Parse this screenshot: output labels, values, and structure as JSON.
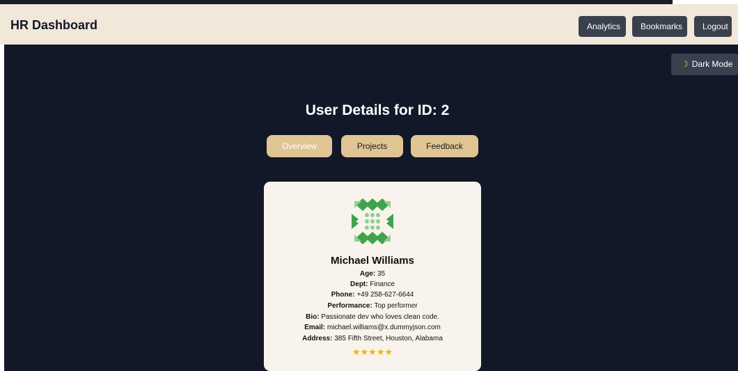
{
  "navbar": {
    "title": "HR Dashboard",
    "buttons": [
      "Analytics",
      "Bookmarks",
      "Logout"
    ]
  },
  "theme_toggle": {
    "icon": "moon-icon",
    "label": "Dark Mode"
  },
  "page": {
    "title": "User Details for ID: 2"
  },
  "tabs": {
    "items": [
      "Overview",
      "Projects",
      "Feedback"
    ],
    "active": "Overview"
  },
  "user": {
    "avatar_icon": "identicon-avatar",
    "name": "Michael Williams",
    "fields": {
      "age": {
        "label": "Age:",
        "value": "35"
      },
      "dept": {
        "label": "Dept:",
        "value": "Finance"
      },
      "phone": {
        "label": "Phone:",
        "value": "+49 258-627-6644"
      },
      "performance": {
        "label": "Performance:",
        "value": "Top performer"
      },
      "bio": {
        "label": "Bio:",
        "value": "Passionate dev who loves clean code."
      },
      "email": {
        "label": "Email:",
        "value": "michael.williams@x.dummyjson.com"
      },
      "address": {
        "label": "Address:",
        "value": "385 Fifth Street, Houston, Alabama"
      }
    },
    "rating": {
      "stars": "★★★★★",
      "value": 5,
      "max": 5
    }
  },
  "colors": {
    "navbar_bg": "#f1e8da",
    "page_bg": "#121828",
    "button_bg": "#3a404d",
    "tab_bg": "#e0c494",
    "card_bg": "#f8f3ec",
    "star": "#f2b500",
    "avatar_green": "#3fa34d"
  }
}
